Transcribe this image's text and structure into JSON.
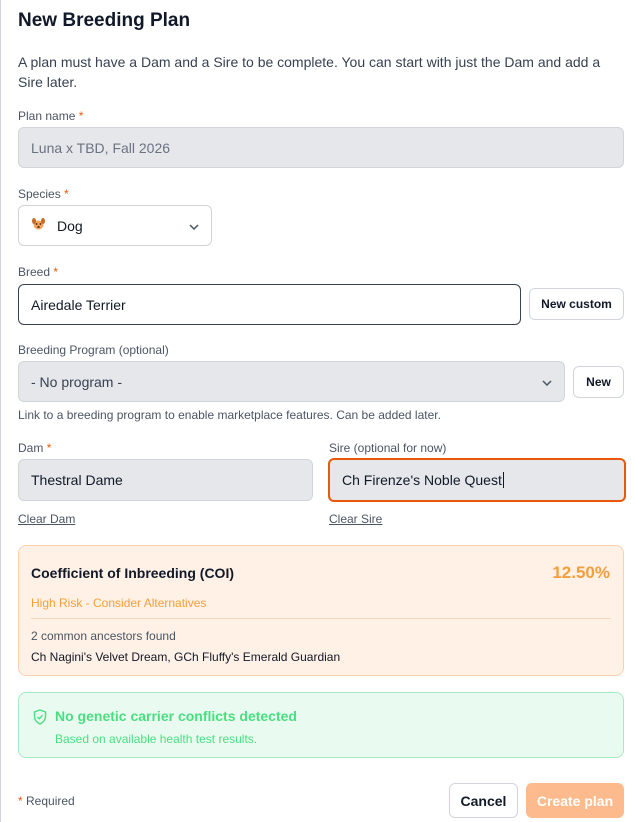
{
  "dialog": {
    "title": "New Breeding Plan",
    "intro": "A plan must have a Dam and a Sire to be complete. You can start with just the Dam and add a Sire later."
  },
  "plan_name": {
    "label": "Plan name",
    "required_mark": "*",
    "placeholder": "Luna x TBD, Fall 2026"
  },
  "species": {
    "label": "Species",
    "required_mark": "*",
    "icon": "dog-icon",
    "value": "Dog"
  },
  "breed": {
    "label": "Breed",
    "required_mark": "*",
    "value": "Airedale Terrier",
    "new_custom_label": "New custom"
  },
  "program": {
    "label": "Breeding Program (optional)",
    "value": "- No program -",
    "new_label": "New",
    "hint": "Link to a breeding program to enable marketplace features. Can be added later."
  },
  "dam": {
    "label": "Dam",
    "required_mark": "*",
    "value": "Thestral Dame",
    "clear_label": "Clear Dam"
  },
  "sire": {
    "label": "Sire (optional for now)",
    "value": "Ch Firenze's Noble Quest",
    "clear_label": "Clear Sire"
  },
  "coi": {
    "title": "Coefficient of Inbreeding (COI)",
    "value": "12.50%",
    "risk": "High Risk - Consider Alternatives",
    "ancestors_count": "2 common ancestors found",
    "ancestors": "Ch Nagini's Velvet Dream, GCh Fluffy's Emerald Guardian"
  },
  "genetics": {
    "title": "No genetic carrier conflicts detected",
    "subtitle": "Based on available health test results."
  },
  "footer": {
    "required_mark": "*",
    "required_text": "Required",
    "cancel_label": "Cancel",
    "create_label": "Create plan"
  },
  "colors": {
    "accent": "#ea580c",
    "warning": "#f59e3c",
    "success": "#4ade80"
  }
}
